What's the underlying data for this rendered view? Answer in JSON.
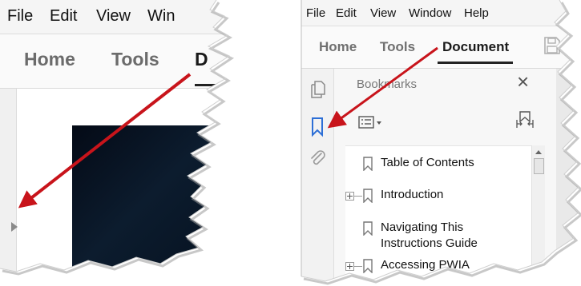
{
  "left": {
    "menu": [
      "File",
      "Edit",
      "View",
      "Win"
    ],
    "tabs": [
      "Home",
      "Tools",
      "D"
    ]
  },
  "right": {
    "menu": {
      "file": "File",
      "edit": "Edit",
      "view": "View",
      "window": "Window",
      "help": "Help"
    },
    "tabs": {
      "home": "Home",
      "tools": "Tools",
      "document": "Document"
    },
    "bookmarks_panel": {
      "title": "Bookmarks",
      "close": "×",
      "items": [
        "Table of Contents",
        "Introduction",
        "Navigating This",
        "Instructions Guide",
        "Accessing PWIA"
      ]
    }
  },
  "colors": {
    "arrow": "#c8141b",
    "bookmark_icon_active": "#2d6fd6"
  }
}
